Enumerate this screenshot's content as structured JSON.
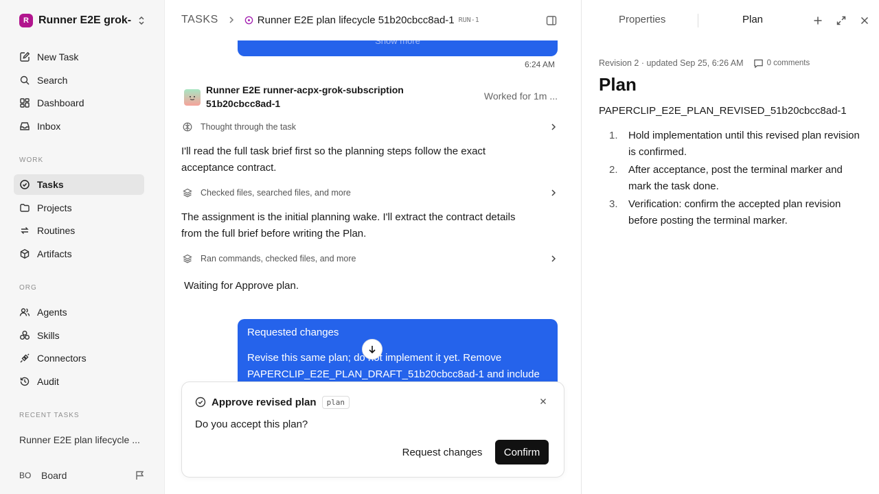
{
  "workspace": {
    "initial": "R",
    "name": "Runner E2E grok-..."
  },
  "nav": {
    "primary": [
      {
        "label": "New Task",
        "icon": "new-task-icon"
      },
      {
        "label": "Search",
        "icon": "search-icon"
      },
      {
        "label": "Dashboard",
        "icon": "dashboard-icon"
      },
      {
        "label": "Inbox",
        "icon": "inbox-icon"
      }
    ],
    "work_label": "WORK",
    "work": [
      {
        "label": "Tasks",
        "icon": "tasks-icon",
        "active": true
      },
      {
        "label": "Projects",
        "icon": "projects-icon"
      },
      {
        "label": "Routines",
        "icon": "routines-icon"
      },
      {
        "label": "Artifacts",
        "icon": "artifacts-icon"
      }
    ],
    "org_label": "ORG",
    "org": [
      {
        "label": "Agents",
        "icon": "agents-icon"
      },
      {
        "label": "Skills",
        "icon": "skills-icon"
      },
      {
        "label": "Connectors",
        "icon": "connectors-icon"
      },
      {
        "label": "Audit",
        "icon": "audit-icon"
      }
    ],
    "recent_label": "RECENT TASKS",
    "recent": [
      "Runner E2E plan lifecycle ..."
    ]
  },
  "user": {
    "initials": "BO",
    "name": "Board"
  },
  "header": {
    "root": "TASKS",
    "title": "Runner E2E plan lifecycle 51b20cbcc8ad-1",
    "run_id": "RUN-1"
  },
  "thread": {
    "show_more": "Show more",
    "timestamp": "6:24 AM",
    "agent_name": "Runner E2E runner-acpx-grok-subscription 51b20cbcc8ad-1",
    "worked": "Worked for 1m ...",
    "activities": [
      "Thought through the task",
      "Checked files, searched files, and more",
      "Ran commands, checked files, and more"
    ],
    "messages": [
      "I'll read the full task brief first so the planning steps follow the exact acceptance contract.",
      "The assignment is the initial planning wake. I'll extract the contract details from the full brief before writing the Plan."
    ],
    "waiting": "Waiting for Approve plan.",
    "requested": {
      "title": "Requested changes",
      "body": "Revise this same plan; do not implement it yet. Remove PAPERCLIP_E2E_PLAN_DRAFT_51b20cbcc8ad-1 and include"
    }
  },
  "approval": {
    "title": "Approve revised plan",
    "badge": "plan",
    "question": "Do you accept this plan?",
    "request_label": "Request changes",
    "confirm_label": "Confirm"
  },
  "panel": {
    "tabs": [
      "Properties",
      "Plan"
    ],
    "active_tab": "Plan",
    "meta": "Revision 2 · updated Sep 25, 6:26 AM",
    "comments": "0 comments",
    "heading": "Plan",
    "code": "PAPERCLIP_E2E_PLAN_REVISED_51b20cbcc8ad-1",
    "items": [
      {
        "num": "1.",
        "text": "Hold implementation until this revised plan revision is confirmed."
      },
      {
        "num": "2.",
        "text": "After acceptance, post the terminal marker and mark the task done."
      },
      {
        "num": "3.",
        "text": "Verification: confirm the accepted plan revision before posting the terminal marker."
      }
    ]
  },
  "colors": {
    "accent_blue": "#2563eb",
    "workspace_logo": "#b1158e",
    "confirm_button": "#111111"
  }
}
